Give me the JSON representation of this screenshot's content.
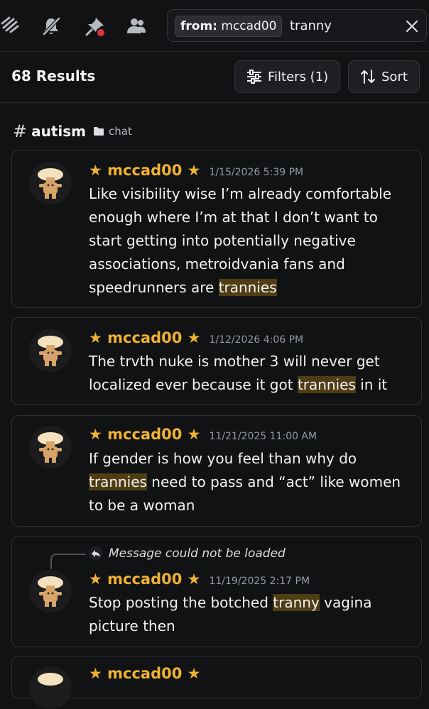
{
  "toolbar": {
    "icons": [
      "threads-icon",
      "bell-muted-icon",
      "pin-icon",
      "members-icon"
    ],
    "notification_color": "#da373c"
  },
  "search": {
    "chip_key": "from:",
    "chip_value": "mccad00",
    "query": "tranny"
  },
  "header": {
    "results": "68 Results",
    "filters_label": "Filters (1)",
    "sort_label": "Sort"
  },
  "channel": {
    "name": "autism",
    "category": "chat"
  },
  "colors": {
    "author": "#f0b232",
    "highlight": "#4f3d14",
    "background": "#121214"
  },
  "messages": [
    {
      "author": "★ mccad00 ★",
      "timestamp": "1/15/2026 5:39 PM",
      "before": "Like visibility wise I’m already comfortable enough where I’m at that I don’t want to start getting into potentially negative associations, metroidvania fans and speedrunners are ",
      "highlight": "trannies",
      "after": ""
    },
    {
      "author": "★ mccad00 ★",
      "timestamp": "1/12/2026 4:06 PM",
      "before": "The trvth nuke is mother 3 will never get localized ever because it got ",
      "highlight": "trannies",
      "after": " in it"
    },
    {
      "author": "★ mccad00 ★",
      "timestamp": "11/21/2025 11:00 AM",
      "before": "If gender is how you feel than why do ",
      "highlight": "trannies",
      "after": " need to pass and “act” like women to be a woman"
    },
    {
      "reply": "Message could not be loaded",
      "author": "★ mccad00 ★",
      "timestamp": "11/19/2025 2:17 PM",
      "before": "Stop posting the botched ",
      "highlight": "tranny",
      "after": " vagina picture then"
    },
    {
      "author": "★ mccad00 ★"
    }
  ]
}
